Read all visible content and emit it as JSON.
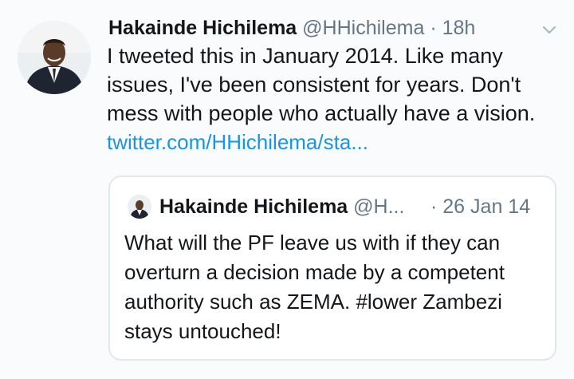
{
  "tweet": {
    "author_name": "Hakainde Hichilema",
    "author_handle": "@HHichilema",
    "separator": "·",
    "time": "18h",
    "text": "I tweeted this in January 2014. Like many issues, I've been consistent for years. Don't mess with people who actually have a vision.",
    "link": "twitter.com/HHichilema/sta...",
    "avatar_icon": "profile-photo",
    "menu_icon": "chevron-down-icon"
  },
  "quoted_tweet": {
    "author_name": "Hakainde Hichilema",
    "author_handle": "@H...",
    "separator": "·",
    "date": "26 Jan 14",
    "text": "What will the PF leave us with if they can overturn a decision made by a competent authority such as ZEMA. #lower Zambezi stays untouched!"
  },
  "colors": {
    "text_primary": "#14171a",
    "text_secondary": "#657786",
    "link": "#1b95e0",
    "border": "#e1e8ed"
  }
}
